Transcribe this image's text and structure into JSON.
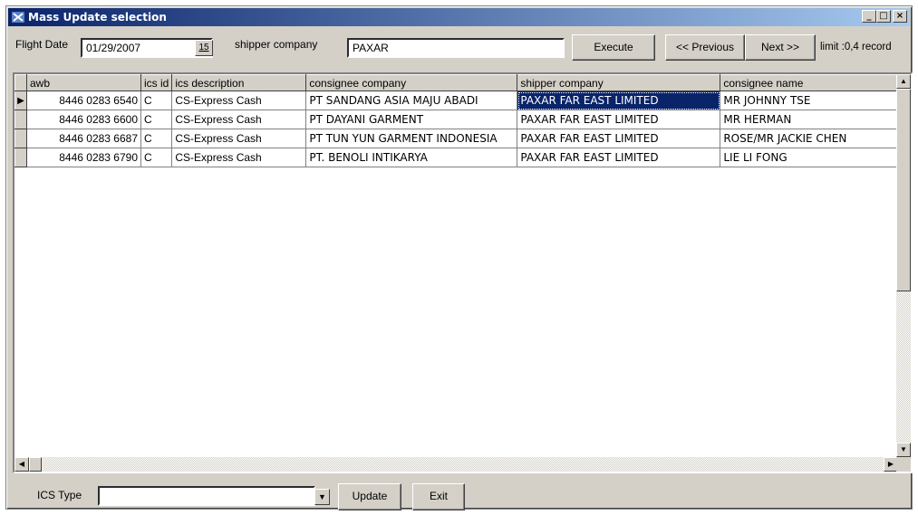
{
  "window": {
    "title": "Mass Update selection",
    "min": "_",
    "max": "□",
    "close": "×"
  },
  "toolbar": {
    "flight_date_label": "Flight Date",
    "flight_date_value": "01/29/2007",
    "calendar_label": "15",
    "shipper_label": "shipper company",
    "shipper_value": "PAXAR",
    "execute_label": "Execute",
    "previous_label": "<< Previous",
    "next_label": "Next >>",
    "limit_text": "limit :0,4 record"
  },
  "grid": {
    "columns": [
      "awb",
      "ics id",
      "ics description",
      "consignee company",
      "shipper company",
      "consignee name"
    ],
    "rows": [
      {
        "awb": "8446 0283 6540",
        "ics_id": "C",
        "ics_desc": "CS-Express Cash",
        "consignee_company": "PT SANDANG ASIA MAJU ABADI",
        "shipper_company": "PAXAR FAR EAST LIMITED",
        "consignee_name": "MR JOHNNY TSE"
      },
      {
        "awb": "8446 0283 6600",
        "ics_id": "C",
        "ics_desc": "CS-Express Cash",
        "consignee_company": "PT DAYANI GARMENT",
        "shipper_company": "PAXAR FAR EAST LIMITED",
        "consignee_name": "MR HERMAN"
      },
      {
        "awb": "8446 0283 6687",
        "ics_id": "C",
        "ics_desc": "CS-Express Cash",
        "consignee_company": "PT TUN YUN GARMENT INDONESIA",
        "shipper_company": "PAXAR FAR EAST LIMITED",
        "consignee_name": "ROSE/MR JACKIE CHEN"
      },
      {
        "awb": "8446 0283 6790",
        "ics_id": "C",
        "ics_desc": "CS-Express Cash",
        "consignee_company": "PT. BENOLI INTIKARYA",
        "shipper_company": "PAXAR FAR EAST LIMITED",
        "consignee_name": "LIE LI FONG"
      }
    ],
    "current_row_marker": "▶"
  },
  "footer": {
    "ics_type_label": "ICS Type",
    "ics_type_value": "",
    "update_label": "Update",
    "exit_label": "Exit"
  },
  "colors": {
    "title_gradient_start": "#0a246a",
    "face": "#d4d0c8",
    "selection": "#0a246a"
  }
}
